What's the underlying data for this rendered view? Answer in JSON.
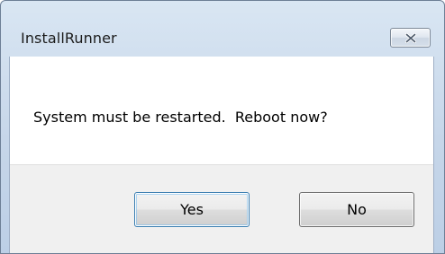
{
  "window": {
    "title": "InstallRunner"
  },
  "dialog": {
    "message": "System must be restarted.  Reboot now?",
    "buttons": {
      "yes_label": "Yes",
      "no_label": "No"
    }
  },
  "icons": {
    "close": "close-icon"
  },
  "colors": {
    "frame": "#c6d6e9",
    "client_background": "#ffffff",
    "button_area": "#f0f0f0",
    "default_button_border": "#3c7fb1"
  }
}
